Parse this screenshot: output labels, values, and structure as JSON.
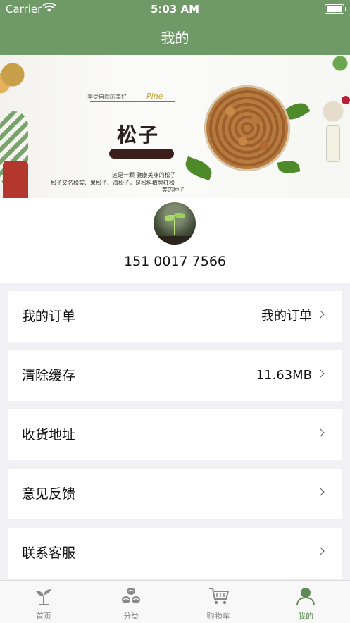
{
  "status_bar": {
    "carrier": "Carrier",
    "time": "5:03 AM"
  },
  "nav": {
    "title": "我的"
  },
  "banner": {
    "tagline": "享受自然的美好",
    "script_word": "Pine",
    "title": "松子",
    "description_line1": "这是一颗 健康美味的松子",
    "description_line2": "松子又名松实、果松子、海松子，是松科植物红松",
    "description_line3": "等的种子"
  },
  "profile": {
    "phone": "151 0017 7566"
  },
  "menu": [
    {
      "label": "我的订单",
      "value": "我的订单"
    },
    {
      "label": "清除缓存",
      "value": "11.63MB"
    },
    {
      "label": "收货地址",
      "value": ""
    },
    {
      "label": "意见反馈",
      "value": ""
    },
    {
      "label": "联系客服",
      "value": ""
    }
  ],
  "tabs": [
    {
      "label": "首页",
      "icon": "sprout-icon"
    },
    {
      "label": "分类",
      "icon": "beans-icon"
    },
    {
      "label": "购物车",
      "icon": "cart-icon"
    },
    {
      "label": "我的",
      "icon": "person-icon",
      "active": true
    }
  ],
  "colors": {
    "accent": "#6f9a67",
    "active_tab": "#5e8a56",
    "inactive_tab": "#888888",
    "background": "#f1f1f5"
  }
}
